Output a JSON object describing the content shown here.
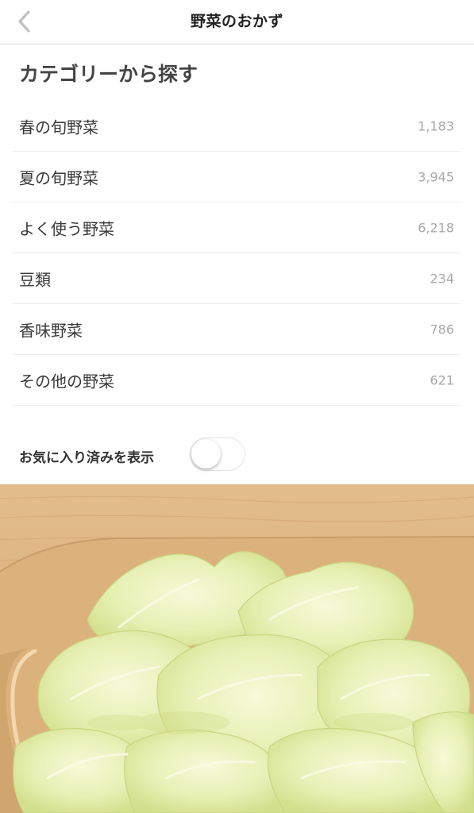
{
  "nav": {
    "title": "野菜のおかず",
    "back_icon": "chevron-left-icon"
  },
  "section": {
    "title": "カテゴリーから探す"
  },
  "categories": [
    {
      "label": "春の旬野菜",
      "count": "1,183"
    },
    {
      "label": "夏の旬野菜",
      "count": "3,945"
    },
    {
      "label": "よく使う野菜",
      "count": "6,218"
    },
    {
      "label": "豆類",
      "count": "234"
    },
    {
      "label": "香味野菜",
      "count": "786"
    },
    {
      "label": "その他の野菜",
      "count": "621"
    }
  ],
  "favorites": {
    "label": "お気に入り済みを表示",
    "toggle_on": false
  },
  "colors": {
    "nav_border": "#dcdcdc",
    "count_text": "#a8a8a8",
    "wood": "#d9b27e",
    "lettuce": "#e6f0b4"
  }
}
